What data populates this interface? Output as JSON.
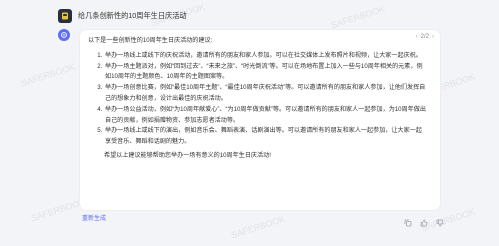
{
  "watermark": "SAFERBOOK",
  "user": {
    "message": "给几条创新性的10周年生日庆活动"
  },
  "response": {
    "pager": "2/2",
    "intro": "以下是一些创新性的10周年生日庆活动的建议:",
    "items": [
      "举办一场线上或线下的庆祝活动，邀请所有的朋友和家人参加。可以在社交媒体上发布照片和视频，让大家一起庆祝。",
      "举办一场主题派对，例如“回到过去”、“未来之旅”、“时光倒流”等。可以在场地布置上加入一些与10周年相关的元素，例如10周年的主题颜色、10周年的主题图案等。",
      "举办一场创意比赛，例如“最佳10周年主题”、“最佳10周年庆祝活动”等。可以邀请所有的朋友和家人参加，让他们发挥自己的想象力和创意，设计出最佳的庆祝活动。",
      "举办一场公益活动，例如“为10周年献爱心”、“为10周年做贡献”等。可以邀请所有的朋友和家人一起参加，为10周年做出自己的贡献，例如捐赠物资、参加志愿者活动等。",
      "举办一场线上或线下的演出，例如音乐会、舞蹈表演、话剧演出等。可以邀请所有的朋友和家人一起参加，让大家一起享受音乐、舞蹈和话剧的魅力。"
    ],
    "outro": "希望以上建议能够帮助您举办一场有意义的10周年生日庆活动!"
  },
  "footer": {
    "regenerate": "重新生成"
  }
}
